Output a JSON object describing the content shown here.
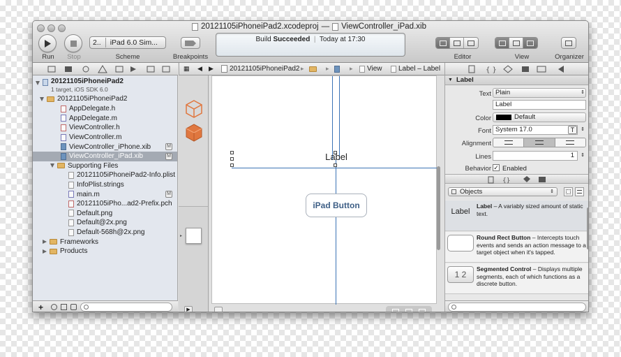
{
  "window": {
    "project_name": "20121105iPhoneiPad2.xcodeproj",
    "separator": "—",
    "file_name": "ViewController_iPad.xib"
  },
  "toolbar": {
    "run_label": "Run",
    "stop_label": "Stop",
    "scheme_target": "2..",
    "scheme_device": "iPad 6.0 Sim...",
    "scheme_label": "Scheme",
    "breakpoints_label": "Breakpoints",
    "editor_label": "Editor",
    "view_label": "View",
    "organizer_label": "Organizer"
  },
  "status": {
    "build_prefix": "Build",
    "build_result": "Succeeded",
    "divider": "|",
    "time": "Today at 17:30"
  },
  "jump_bar": {
    "project": "20121105iPhoneiPad2",
    "view": "View",
    "label": "Label – Label"
  },
  "navigator": {
    "project": {
      "name": "20121105iPhoneiPad2",
      "subtitle": "1 target, iOS SDK 6.0"
    },
    "group": "20121105iPhoneiPad2",
    "files": [
      {
        "name": "AppDelegate.h"
      },
      {
        "name": "AppDelegate.m"
      },
      {
        "name": "ViewController.h"
      },
      {
        "name": "ViewController.m"
      },
      {
        "name": "ViewController_iPhone.xib",
        "badge": "M"
      },
      {
        "name": "ViewController_iPad.xib",
        "badge": "M"
      }
    ],
    "supporting_group": "Supporting Files",
    "supporting_files": [
      {
        "name": "20121105iPhoneiPad2-Info.plist"
      },
      {
        "name": "InfoPlist.strings"
      },
      {
        "name": "main.m",
        "badge": "M"
      },
      {
        "name": "20121105iPho...ad2-Prefix.pch"
      },
      {
        "name": "Default.png"
      },
      {
        "name": "Default@2x.png"
      },
      {
        "name": "Default-568h@2x.png"
      }
    ],
    "frameworks": "Frameworks",
    "products": "Products",
    "add_symbol": "+"
  },
  "canvas": {
    "label_text": "Label",
    "button_text": "iPad Button"
  },
  "inspector": {
    "section_title": "Label",
    "text_label": "Text",
    "text_type": "Plain",
    "text_value": "Label",
    "color_label": "Color",
    "color_value": "Default",
    "font_label": "Font",
    "font_value": "System 17.0",
    "font_button": "T",
    "alignment_label": "Alignment",
    "lines_label": "Lines",
    "lines_value": "1",
    "behavior_label": "Behavior",
    "behavior_value": "Enabled",
    "behavior_checked": true,
    "library_filter": "Objects",
    "library": [
      {
        "thumb": "Label",
        "title": "Label",
        "desc": " – A variably sized amount of static text."
      },
      {
        "thumb": "",
        "title": "Round Rect Button",
        "desc": " – Intercepts touch events and sends an action message to a target object when it's tapped."
      },
      {
        "thumb": "1  2",
        "title": "Segmented Control",
        "desc": " – Displays multiple segments, each of which functions as a discrete button."
      }
    ]
  },
  "colors": {
    "selection": "#a4aab3",
    "guide": "#3b73b5",
    "cube": "#e0773f"
  }
}
